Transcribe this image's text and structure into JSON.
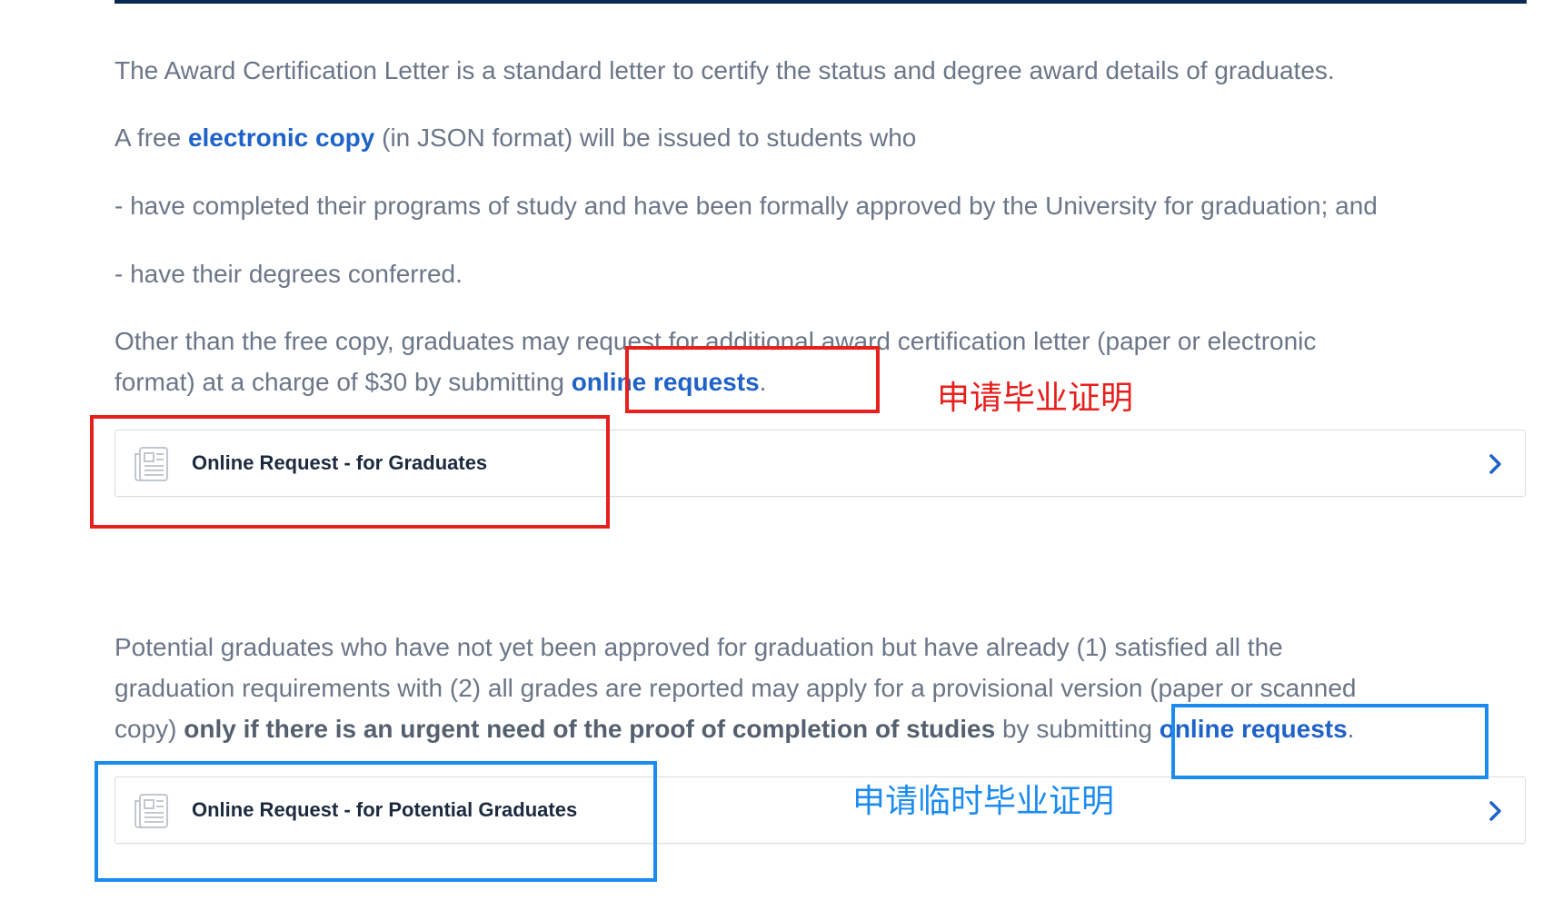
{
  "content": {
    "p1": "The Award Certification Letter is a standard letter to certify the status and degree award details of graduates.",
    "p2": {
      "before": "A free ",
      "link": "electronic copy",
      "after": " (in JSON format) will be issued to students who"
    },
    "p3": "- have completed their programs of study and have been formally approved by the University for graduation; and",
    "p4": "- have their degrees conferred.",
    "p5": {
      "line1": "Other than the free copy, graduates may request for additional award certification letter (paper or electronic",
      "line2_before": "format) at a charge of $30 by submitting ",
      "link": "online requests",
      "after": "."
    },
    "p6": {
      "line1": "Potential graduates who have not yet been approved for graduation but have already (1) satisfied all the",
      "line2": "graduation requirements with (2) all grades are reported may apply for a provisional version (paper or scanned",
      "line3_before": "copy) ",
      "bold": "only if there is an urgent need of the proof of completion of studies",
      "line3_mid": " by submitting ",
      "link": "online requests",
      "after": "."
    }
  },
  "cards": {
    "graduates": {
      "label": "Online Request - for Graduates",
      "icon": "newspaper-icon",
      "chevron": "chevron-right-icon"
    },
    "potential": {
      "label": "Online Request - for Potential Graduates",
      "icon": "newspaper-icon",
      "chevron": "chevron-right-icon"
    }
  },
  "annotations": {
    "red_label": "申请毕业证明",
    "blue_label": "申请临时毕业证明",
    "red_color": "#e6201d",
    "blue_color": "#1b8bf0"
  },
  "colors": {
    "text": "#6b7688",
    "link": "#1f62c8",
    "card_label": "#1c2a3f",
    "top_rule": "#0b2a52"
  }
}
